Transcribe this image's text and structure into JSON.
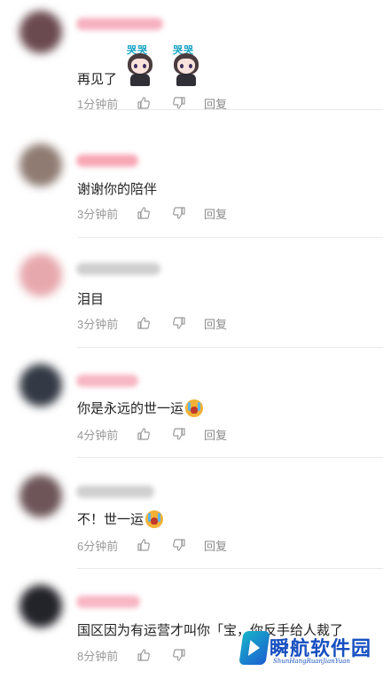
{
  "comments": [
    {
      "text": "再见了",
      "time": "1分钟前",
      "reply_label": "回复",
      "sticker_labels": [
        "哭哭",
        "哭哭"
      ],
      "avatar_color": "#6b4a4f",
      "username_color": "#f6b2c0"
    },
    {
      "text": "谢谢你的陪伴",
      "time": "3分钟前",
      "reply_label": "回复",
      "avatar_color": "#8f7b72",
      "username_color": "#f7a7b5"
    },
    {
      "text": "泪目",
      "time": "3分钟前",
      "reply_label": "回复",
      "avatar_color": "#e7a8ad",
      "username_color": "#cfcfcf"
    },
    {
      "text": "你是永远的世一运",
      "time": "4分钟前",
      "reply_label": "回复",
      "emoji": "crying-face",
      "avatar_color": "#343a45",
      "username_color": "#f7b6c3"
    },
    {
      "text": "不！世一运",
      "time": "6分钟前",
      "reply_label": "回复",
      "emoji": "crying-face",
      "avatar_color": "#6d5558",
      "username_color": "#cfcfcf"
    },
    {
      "text": "国区因为有运营才叫你「宝，你反手给人裁了",
      "time": "8分钟前",
      "avatar_color": "#23232a",
      "username_color": "#f7b6c3"
    }
  ],
  "icons": {
    "like": "thumbs-up-icon",
    "dislike": "thumbs-down-icon",
    "emoji": "crying-face-emoji-icon"
  },
  "watermark": {
    "title": "瞬航软件园",
    "subtitle": "ShunHangRuanJianYuan"
  }
}
